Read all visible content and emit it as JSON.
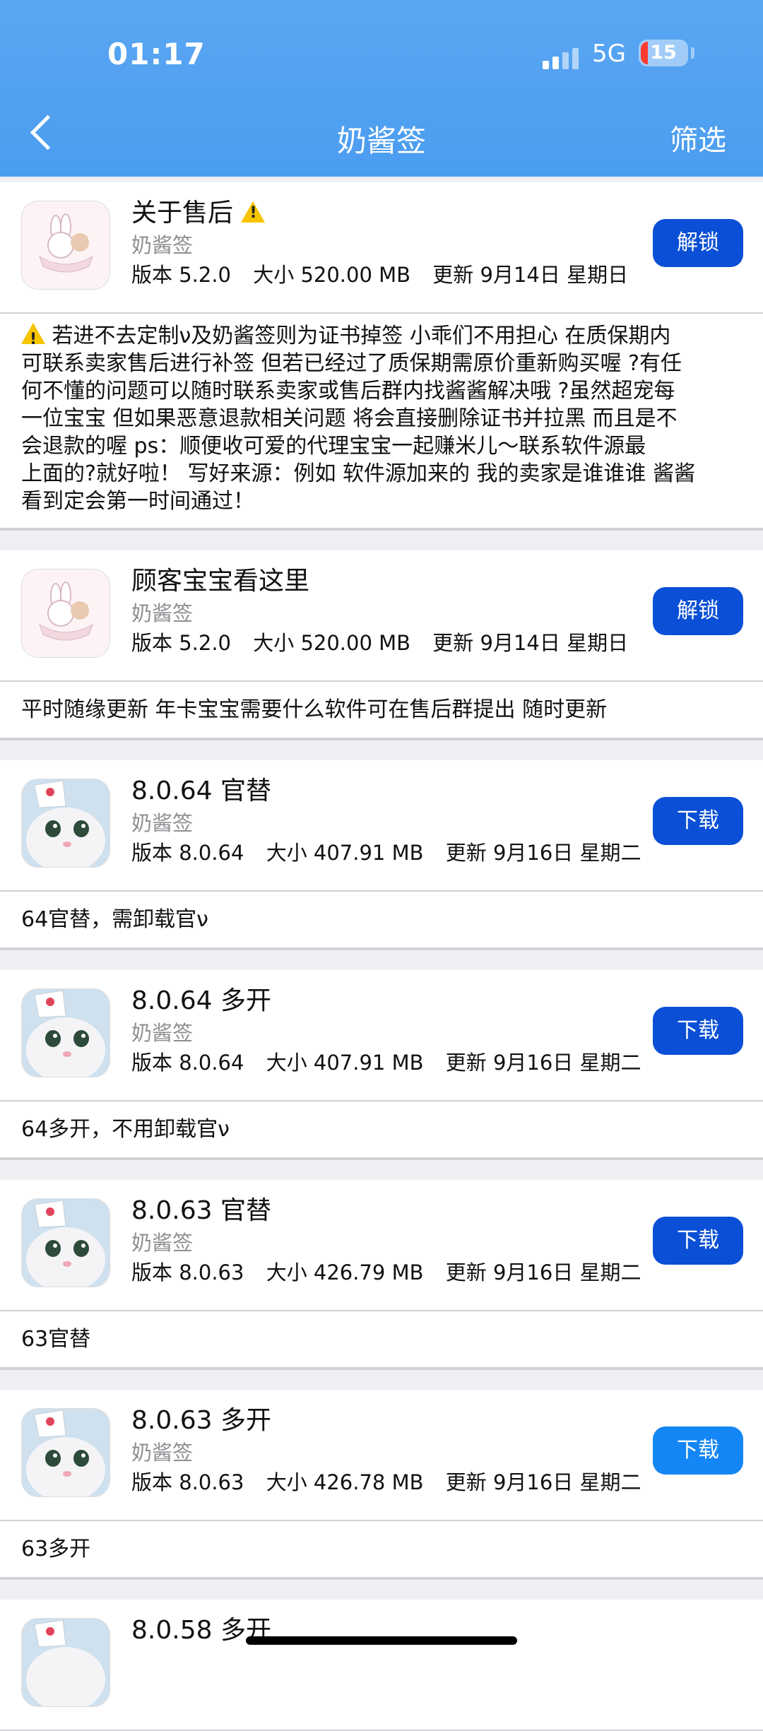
{
  "status": {
    "time": "01:17",
    "network": "5G",
    "battery": "15"
  },
  "nav": {
    "title": "奶酱签",
    "filter": "筛选"
  },
  "apps": [
    {
      "name": "关于售后",
      "warn": true,
      "developer": "奶酱签",
      "version": "版本 5.2.0",
      "size": "大小 520.00 MB",
      "updated": "更新 9月14日 星期日",
      "button": "解锁",
      "icon": "bunny-cartoon-icon",
      "description": [
        "若进不去定制ν及奶酱签则为证书掉签 小乖们不用担心 在质保期内",
        "可联系卖家售后进行补签 但若已经过了质保期需原价重新购买喔 ?有任",
        "何不懂的问题可以随时联系卖家或售后群内找酱酱解决哦 ?虽然超宠每",
        "一位宝宝 但如果恶意退款相关问题 将会直接删除证书并拉黑 而且是不",
        "会退款的喔 ps：顺便收可爱的代理宝宝一起赚米儿～联系软件源最",
        "上面的?就好啦！ 写好来源：例如 软件源加来的 我的卖家是谁谁谁 酱酱",
        "看到定会第一时间通过！"
      ]
    },
    {
      "name": "顾客宝宝看这里",
      "warn": false,
      "developer": "奶酱签",
      "version": "版本 5.2.0",
      "size": "大小 520.00 MB",
      "updated": "更新 9月14日 星期日",
      "button": "解锁",
      "icon": "bunny-cartoon-icon",
      "description": [
        "平时随缘更新 年卡宝宝需要什么软件可在售后群提出 随时更新"
      ]
    },
    {
      "name": "8.0.64 官替",
      "developer": "奶酱签",
      "version": "版本 8.0.64",
      "size": "大小 407.91 MB",
      "updated": "更新 9月16日 星期二",
      "button": "下载",
      "icon": "cat-nurse-icon",
      "description": [
        "64官替，需卸载官ν"
      ]
    },
    {
      "name": "8.0.64 多开",
      "developer": "奶酱签",
      "version": "版本 8.0.64",
      "size": "大小 407.91 MB",
      "updated": "更新 9月16日 星期二",
      "button": "下载",
      "icon": "cat-nurse-icon",
      "description": [
        "64多开，不用卸载官ν"
      ]
    },
    {
      "name": "8.0.63 官替",
      "developer": "奶酱签",
      "version": "版本 8.0.63",
      "size": "大小 426.79 MB",
      "updated": "更新 9月16日 星期二",
      "button": "下载",
      "icon": "cat-nurse-icon",
      "description": [
        "63官替"
      ]
    },
    {
      "name": "8.0.63 多开",
      "developer": "奶酱签",
      "version": "版本 8.0.63",
      "size": "大小 426.78 MB",
      "updated": "更新 9月16日 星期二",
      "button": "下载",
      "icon": "cat-nurse-icon",
      "description": [
        "63多开"
      ]
    },
    {
      "name": "8.0.58 多开",
      "developer": "",
      "version": "",
      "size": "",
      "updated": "",
      "button": "",
      "icon": "cat-nurse-icon",
      "description": []
    }
  ]
}
